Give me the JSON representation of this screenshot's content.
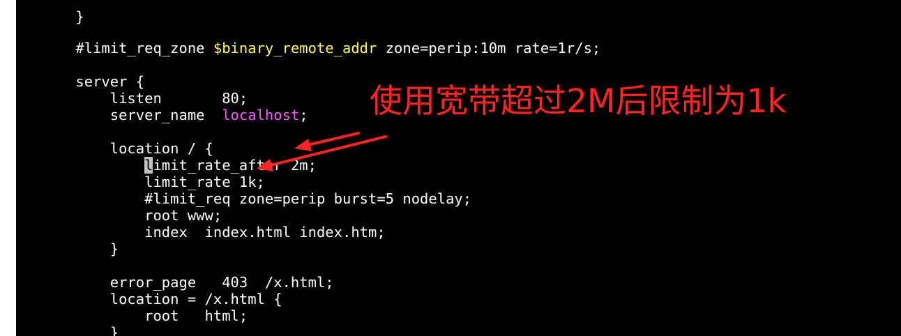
{
  "colors": {
    "background": "#000000",
    "text": "#ffffff",
    "variable": "#ffff54",
    "string": "#ff55ff",
    "annotation": "#ff2323",
    "cursor": "#c0c0c0"
  },
  "editor": {
    "top_brace": "}",
    "line_limit_zone_a": "#limit_req_zone ",
    "line_limit_zone_var": "$binary_remote_addr",
    "line_limit_zone_b": " zone=perip:10m rate=1r/s;",
    "line_server": "server {",
    "line_listen": "    listen       80;",
    "line_server_name_a": "    server_name  ",
    "line_server_name_val": "localhost",
    "line_server_name_b": ";",
    "line_location": "    location / {",
    "line_rate_after_indent": "        ",
    "line_rate_after_cursor": "l",
    "line_rate_after_rest": "imit_rate_after 2m;",
    "line_limit_rate": "        limit_rate 1k;",
    "line_limit_req": "        #limit_req zone=perip burst=5 nodelay;",
    "line_root": "        root www;",
    "line_index": "        index  index.html index.htm;",
    "line_close_location": "    }",
    "line_error_page": "    error_page   403  /x.html;",
    "line_location_x": "    location = /x.html {",
    "line_root_html": "        root   html;",
    "line_close_location_x": "    }"
  },
  "annotation": {
    "text": "使用宽带超过2M后限制为1k",
    "icons": [
      "arrow-icon",
      "arrow-icon"
    ]
  }
}
